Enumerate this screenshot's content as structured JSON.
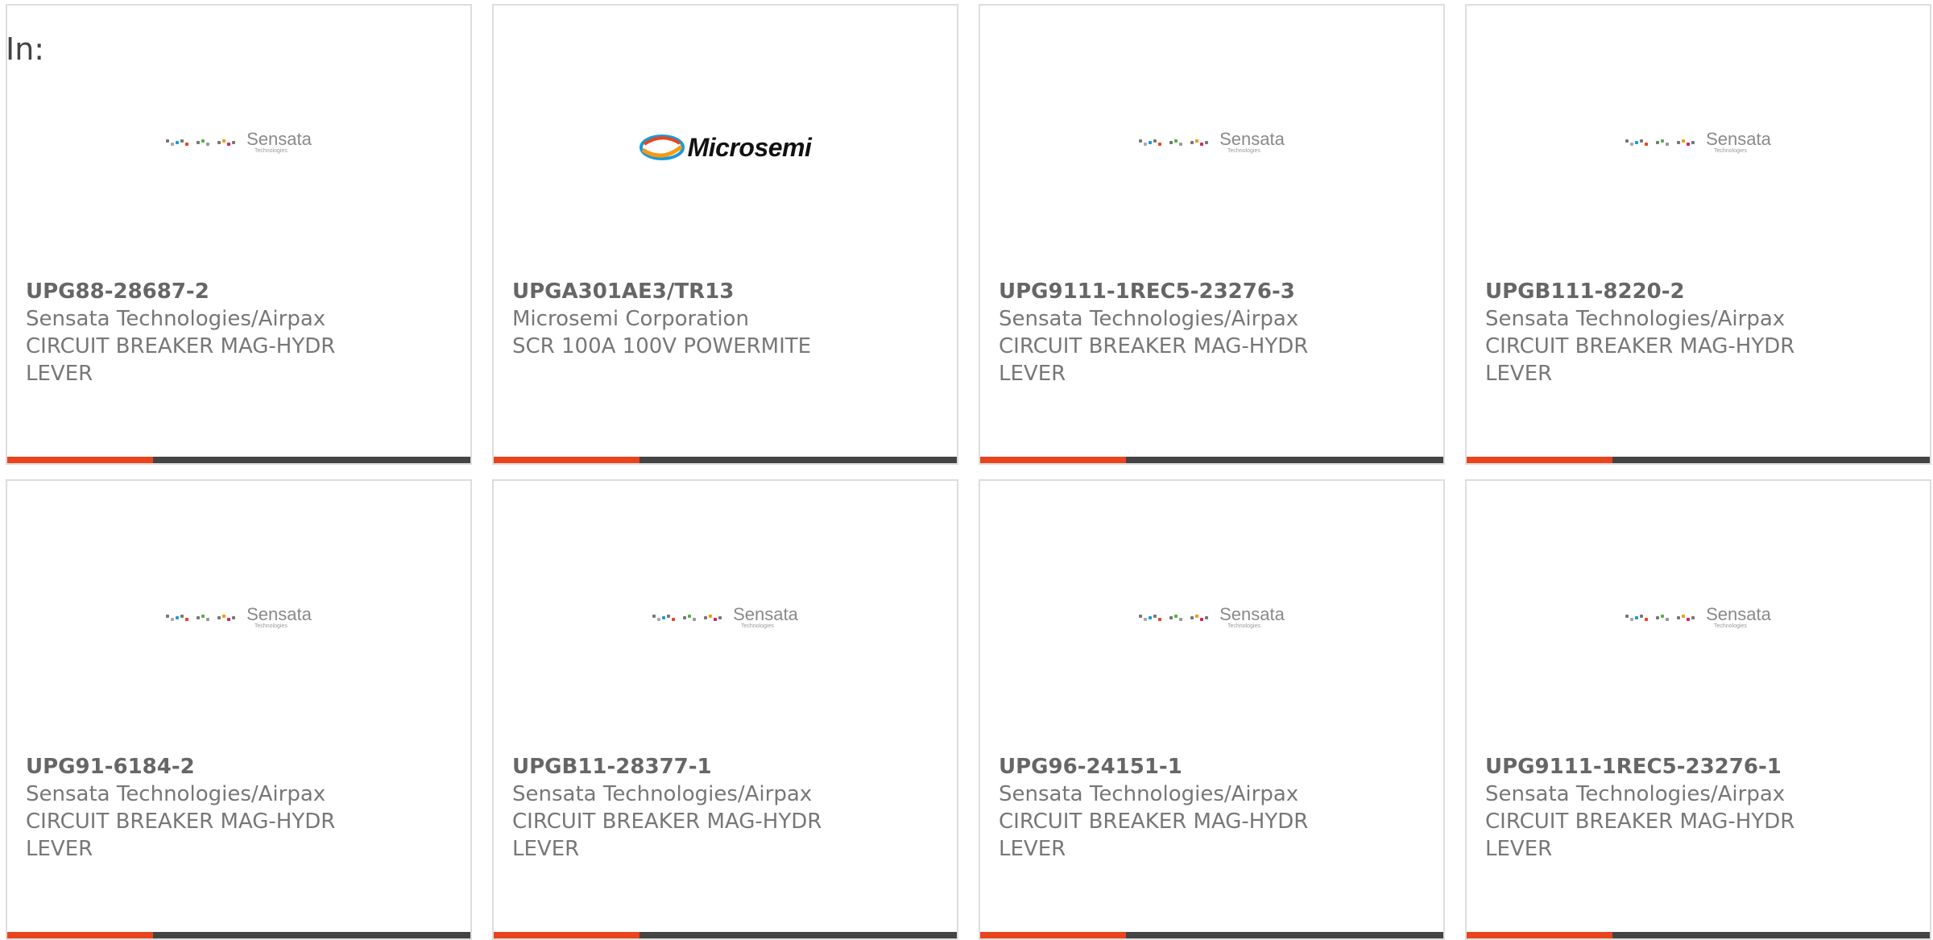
{
  "in_label": "In:",
  "colors": {
    "accent": "#e8451e",
    "bar": "#444444",
    "card_border": "#dddddd",
    "text": "#777777"
  },
  "products": [
    {
      "part_number": "UPG88-28687-2",
      "manufacturer": "Sensata Technologies/Airpax",
      "description": "CIRCUIT BREAKER MAG-HYDR LEVER",
      "logo": "sensata",
      "logo_text": "Sensata",
      "logo_subtext": "Technologies"
    },
    {
      "part_number": "UPGA301AE3/TR13",
      "manufacturer": "Microsemi Corporation",
      "description": "SCR 100A 100V POWERMITE",
      "logo": "microsemi",
      "logo_text": "Microsemi",
      "logo_subtext": ""
    },
    {
      "part_number": "UPG9111-1REC5-23276-3",
      "manufacturer": "Sensata Technologies/Airpax",
      "description": "CIRCUIT BREAKER MAG-HYDR LEVER",
      "logo": "sensata",
      "logo_text": "Sensata",
      "logo_subtext": "Technologies"
    },
    {
      "part_number": "UPGB111-8220-2",
      "manufacturer": "Sensata Technologies/Airpax",
      "description": "CIRCUIT BREAKER MAG-HYDR LEVER",
      "logo": "sensata",
      "logo_text": "Sensata",
      "logo_subtext": "Technologies"
    },
    {
      "part_number": "UPG91-6184-2",
      "manufacturer": "Sensata Technologies/Airpax",
      "description": "CIRCUIT BREAKER MAG-HYDR LEVER",
      "logo": "sensata",
      "logo_text": "Sensata",
      "logo_subtext": "Technologies"
    },
    {
      "part_number": "UPGB11-28377-1",
      "manufacturer": "Sensata Technologies/Airpax",
      "description": "CIRCUIT BREAKER MAG-HYDR LEVER",
      "logo": "sensata",
      "logo_text": "Sensata",
      "logo_subtext": "Technologies"
    },
    {
      "part_number": "UPG96-24151-1",
      "manufacturer": "Sensata Technologies/Airpax",
      "description": "CIRCUIT BREAKER MAG-HYDR LEVER",
      "logo": "sensata",
      "logo_text": "Sensata",
      "logo_subtext": "Technologies"
    },
    {
      "part_number": "UPG9111-1REC5-23276-1",
      "manufacturer": "Sensata Technologies/Airpax",
      "description": "CIRCUIT BREAKER MAG-HYDR LEVER",
      "logo": "sensata",
      "logo_text": "Sensata",
      "logo_subtext": "Technologies"
    }
  ]
}
